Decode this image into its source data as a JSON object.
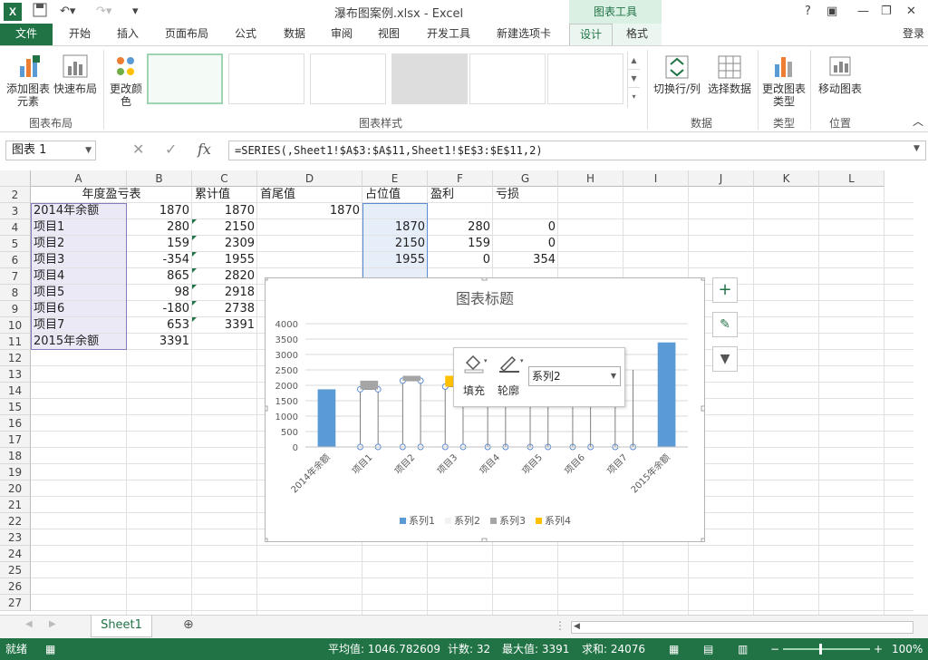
{
  "titlebar": {
    "title": "瀑布图案例.xlsx - Excel",
    "chart_tools": "图表工具",
    "help": "?",
    "login": "登录"
  },
  "tabs": [
    "文件",
    "开始",
    "插入",
    "页面布局",
    "公式",
    "数据",
    "审阅",
    "视图",
    "开发工具",
    "新建选项卡",
    "设计",
    "格式"
  ],
  "ribbon": {
    "add_element": "添加图表元素",
    "quick_layout": "快速布局",
    "change_color": "更改颜色",
    "group_layout": "图表布局",
    "group_styles": "图表样式",
    "switch_row_col": "切换行/列",
    "select_data": "选择数据",
    "group_data": "数据",
    "change_type": "更改图表类型",
    "group_type": "类型",
    "move_chart": "移动图表",
    "group_location": "位置"
  },
  "formula_bar": {
    "name_box": "图表 1",
    "formula": "=SERIES(,Sheet1!$A$3:$A$11,Sheet1!$E$3:$E$11,2)",
    "fx": "fx"
  },
  "columns": [
    "A",
    "B",
    "C",
    "D",
    "E",
    "F",
    "G",
    "H",
    "I",
    "J",
    "K",
    "L"
  ],
  "rows": [
    "2",
    "3",
    "4",
    "5",
    "6",
    "7",
    "8",
    "9",
    "10",
    "11",
    "12",
    "13",
    "14",
    "15",
    "16",
    "17",
    "18",
    "19",
    "20",
    "21",
    "22",
    "23",
    "24",
    "25",
    "26",
    "27"
  ],
  "headers": {
    "a": "年度盈亏表",
    "c": "累计值",
    "d": "首尾值",
    "e": "占位值",
    "f": "盈利",
    "g": "亏损"
  },
  "table": [
    {
      "a": "2014年余额",
      "b": "1870",
      "c": "1870",
      "d": "1870",
      "e": "",
      "f": "",
      "g": ""
    },
    {
      "a": "项目1",
      "b": "280",
      "c": "2150",
      "d": "",
      "e": "1870",
      "f": "280",
      "g": "0"
    },
    {
      "a": "项目2",
      "b": "159",
      "c": "2309",
      "d": "",
      "e": "2150",
      "f": "159",
      "g": "0"
    },
    {
      "a": "项目3",
      "b": "-354",
      "c": "1955",
      "d": "",
      "e": "1955",
      "f": "0",
      "g": "354"
    },
    {
      "a": "项目4",
      "b": "865",
      "c": "2820",
      "d": "",
      "e": "",
      "f": "",
      "g": ""
    },
    {
      "a": "项目5",
      "b": "98",
      "c": "2918",
      "d": "",
      "e": "",
      "f": "",
      "g": ""
    },
    {
      "a": "项目6",
      "b": "-180",
      "c": "2738",
      "d": "",
      "e": "",
      "f": "",
      "g": ""
    },
    {
      "a": "项目7",
      "b": "653",
      "c": "3391",
      "d": "",
      "e": "",
      "f": "",
      "g": ""
    },
    {
      "a": "2015年余额",
      "b": "3391",
      "c": "",
      "d": "",
      "e": "",
      "f": "",
      "g": ""
    }
  ],
  "chart_data": {
    "type": "bar",
    "title": "图表标题",
    "categories": [
      "2014年余额",
      "项目1",
      "项目2",
      "项目3",
      "项目4",
      "项目5",
      "项目6",
      "项目7",
      "2015年余额"
    ],
    "ylim": [
      0,
      4000
    ],
    "yticks": [
      "0",
      "500",
      "1000",
      "1500",
      "2000",
      "2500",
      "3000",
      "3500",
      "4000"
    ],
    "grid": true,
    "legend_position": "bottom",
    "series": [
      {
        "name": "系列1",
        "color": "#5b9bd5",
        "values": [
          1870,
          0,
          0,
          0,
          0,
          0,
          0,
          0,
          3391
        ]
      },
      {
        "name": "系列2",
        "color": "#ffffff",
        "values": [
          0,
          1870,
          2150,
          1955,
          0,
          0,
          0,
          0,
          0
        ]
      },
      {
        "name": "系列3",
        "color": "#a5a5a5",
        "values": [
          0,
          280,
          159,
          0,
          0,
          0,
          0,
          0,
          0
        ]
      },
      {
        "name": "系列4",
        "color": "#ffc000",
        "values": [
          0,
          0,
          0,
          354,
          0,
          0,
          0,
          0,
          0
        ]
      }
    ]
  },
  "mini_toolbar": {
    "fill": "填充",
    "outline": "轮廓",
    "series_select": "系列2"
  },
  "sheet_tab": "Sheet1",
  "status": {
    "ready": "就绪",
    "average": "平均值: 1046.782609",
    "count": "计数: 32",
    "max": "最大值: 3391",
    "sum": "求和: 24076",
    "zoom": "100%"
  }
}
